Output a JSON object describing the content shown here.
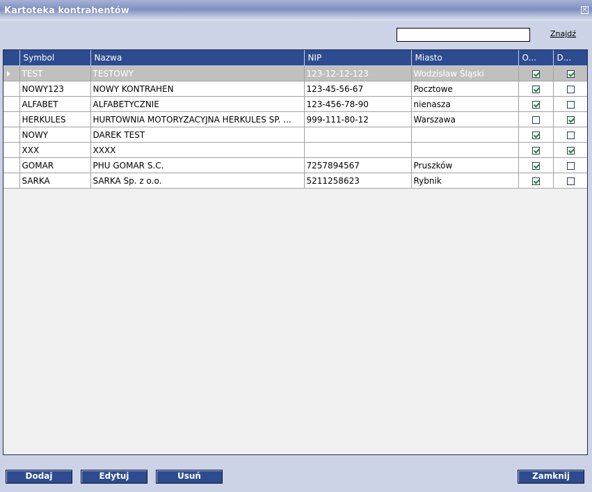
{
  "window": {
    "title": "Kartoteka kontrahentów",
    "close_symbol": "✕"
  },
  "search": {
    "value": "",
    "find_label": "Znajdź"
  },
  "table": {
    "columns": [
      "",
      "Symbol",
      "Nazwa",
      "NIP",
      "Miasto",
      "O...",
      "D..."
    ],
    "rows": [
      {
        "symbol": "TEST",
        "nazwa": "TESTOWY",
        "nip": "123-12-12-123",
        "miasto": "Wodzisław Śląski",
        "o": true,
        "d": true,
        "selected": true
      },
      {
        "symbol": "NOWY123",
        "nazwa": "NOWY KONTRAHEN",
        "nip": "123-45-56-67",
        "miasto": "Pocztowe",
        "o": true,
        "d": false
      },
      {
        "symbol": "ALFABET",
        "nazwa": "ALFABETYCZNIE",
        "nip": "123-456-78-90",
        "miasto": "nienasza",
        "o": true,
        "d": false
      },
      {
        "symbol": "HERKULES",
        "nazwa": "HURTOWNIA MOTORYZACYJNA HERKULES SP. ...",
        "nip": "999-111-80-12",
        "miasto": "Warszawa",
        "o": false,
        "d": true
      },
      {
        "symbol": "NOWY",
        "nazwa": "DAREK TEST",
        "nip": "",
        "miasto": "",
        "o": true,
        "d": false
      },
      {
        "symbol": "XXX",
        "nazwa": "XXXX",
        "nip": "",
        "miasto": "",
        "o": true,
        "d": true
      },
      {
        "symbol": "GOMAR",
        "nazwa": "PHU GOMAR S.C.",
        "nip": "7257894567",
        "miasto": "Pruszków",
        "o": true,
        "d": false
      },
      {
        "symbol": "SARKA",
        "nazwa": "SARKA Sp. z o.o.",
        "nip": "5211258623",
        "miasto": "Rybnik",
        "o": true,
        "d": false
      }
    ]
  },
  "buttons": {
    "add": "Dodaj",
    "edit": "Edytuj",
    "delete": "Usuń",
    "close": "Zamknij"
  }
}
